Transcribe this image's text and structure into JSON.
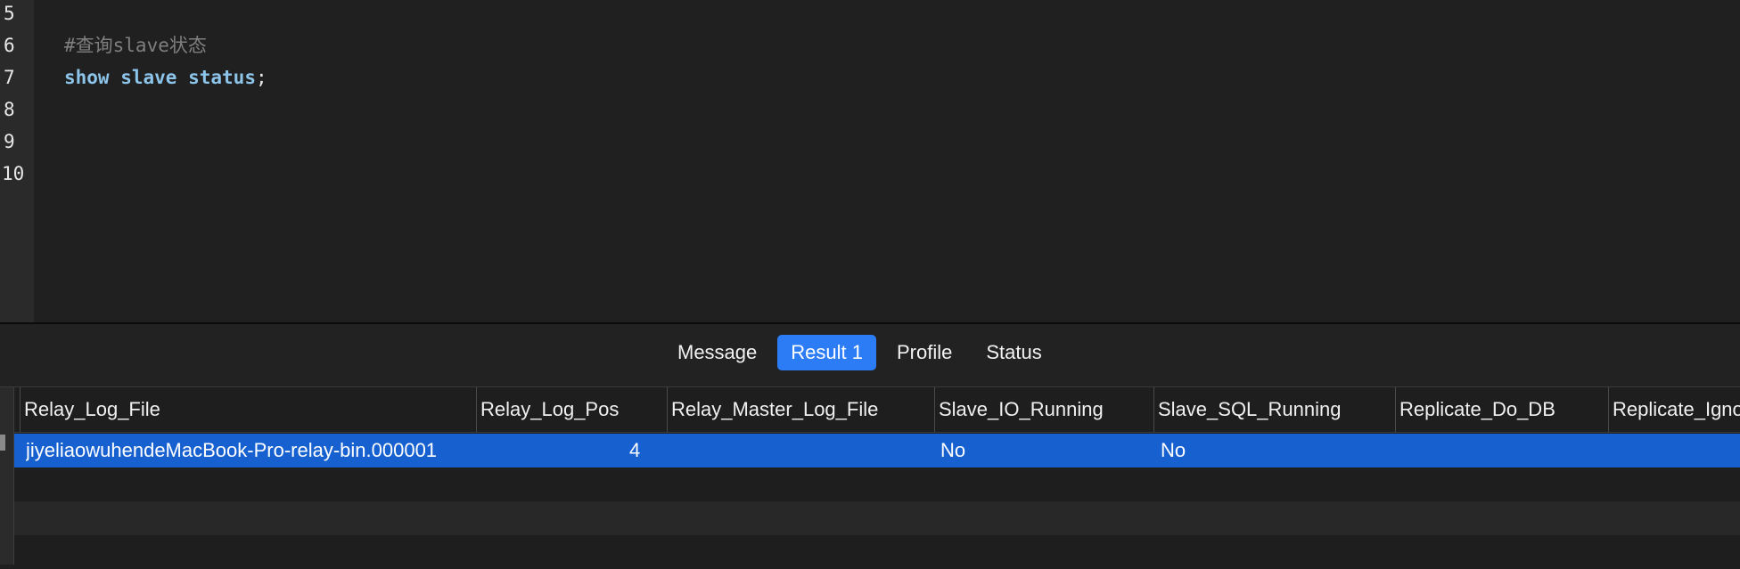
{
  "editor": {
    "lines": [
      {
        "number": "5",
        "text": ""
      },
      {
        "number": "6",
        "text": "#查询slave状态"
      },
      {
        "number": "7",
        "kw1": "show",
        "kw2": "slave",
        "kw3": "status",
        "punct": ";"
      },
      {
        "number": "8",
        "text": ""
      },
      {
        "number": "9",
        "text": ""
      },
      {
        "number": "10",
        "text": ""
      }
    ]
  },
  "result_tabs": [
    {
      "label": "Message",
      "active": false
    },
    {
      "label": "Result 1",
      "active": true
    },
    {
      "label": "Profile",
      "active": false
    },
    {
      "label": "Status",
      "active": false
    }
  ],
  "grid": {
    "columns": [
      "Relay_Log_File",
      "Relay_Log_Pos",
      "Relay_Master_Log_File",
      "Slave_IO_Running",
      "Slave_SQL_Running",
      "Replicate_Do_DB",
      "Replicate_Ignore_DB"
    ],
    "rows": [
      [
        "jiyeliaowuhendeMacBook-Pro-relay-bin.000001",
        "4",
        "",
        "No",
        "No",
        "",
        ""
      ]
    ]
  },
  "colors": {
    "selected_row": "#1660d0",
    "active_tab": "#2c7cf5",
    "keyword": "#8cc4ea",
    "comment": "#7f7f7f"
  }
}
